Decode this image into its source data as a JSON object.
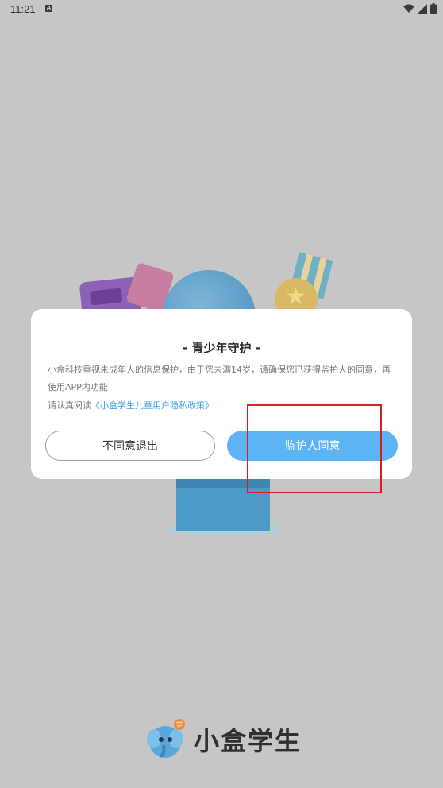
{
  "status_bar": {
    "time": "11:21",
    "notification_badge": "A",
    "icons": [
      "wifi-icon",
      "signal-icon",
      "battery-icon"
    ]
  },
  "dialog": {
    "title": "- 青少年守护 -",
    "body": "小盒科技重视未成年人的信息保护，由于您未满14岁，请确保您已获得监护人的同意，再使用APP内功能",
    "privacy_prefix": "请认真阅读",
    "privacy_link": "《小盒学生儿童用户隐私政策》",
    "disagree_button": "不同意退出",
    "agree_button": "监护人同意"
  },
  "brand": {
    "name": "小盒学生",
    "logo_icon": "elephant-mascot-icon"
  },
  "colors": {
    "overlay_background": "#c6c6c6",
    "agree_button": "#5db4f4",
    "link": "#3ea0e8",
    "highlight_box": "#d81e1e"
  }
}
